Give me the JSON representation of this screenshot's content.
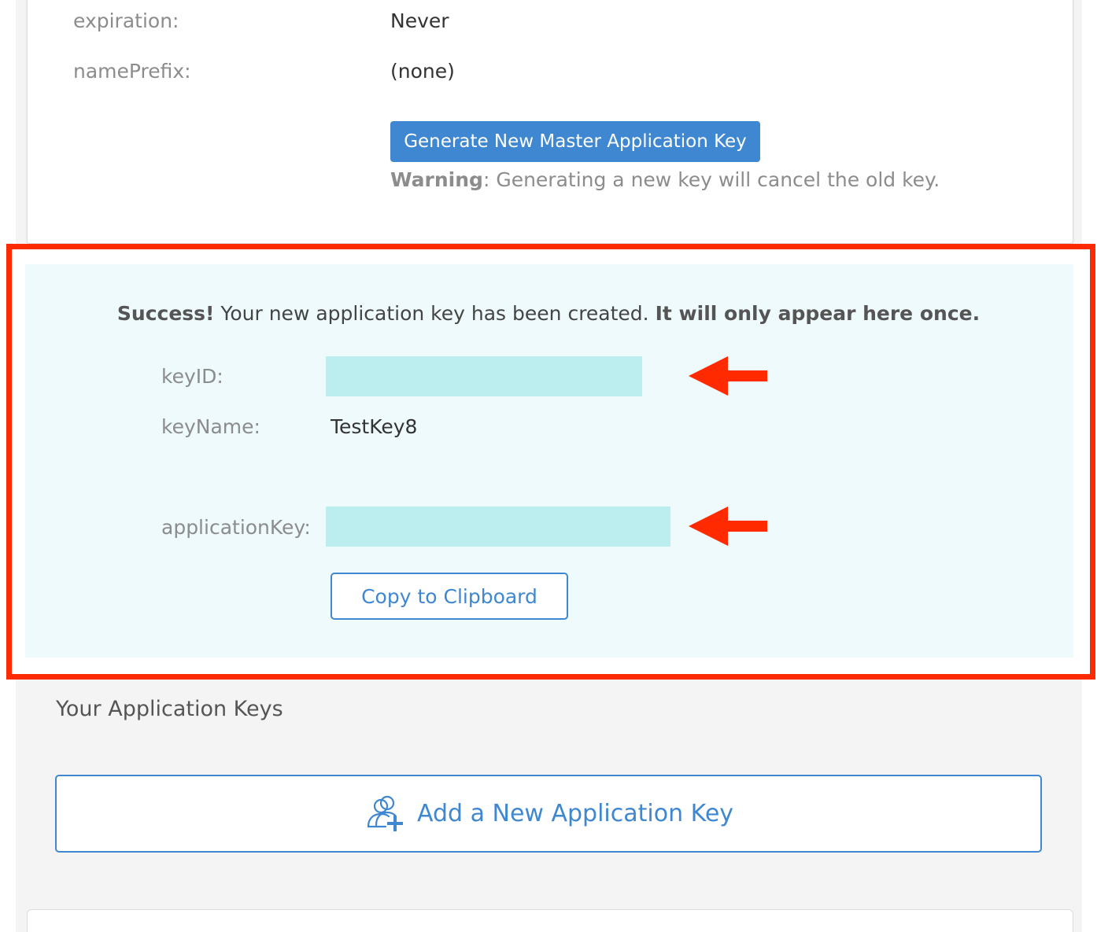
{
  "master_key": {
    "rows": [
      {
        "label": "expiration:",
        "value": "Never"
      },
      {
        "label": "namePrefix:",
        "value": "(none)"
      }
    ],
    "generate_button": "Generate New Master Application Key",
    "warning_strong": "Warning",
    "warning_text": ": Generating a new key will cancel the old key."
  },
  "success": {
    "strong_prefix": "Success!",
    "message": " Your new application key has been created. ",
    "strong_suffix": "It will only appear here once.",
    "fields": {
      "key_id_label": "keyID:",
      "key_name_label": "keyName:",
      "key_name_value": "TestKey8",
      "application_key_label": "applicationKey:"
    },
    "copy_button": "Copy to Clipboard"
  },
  "application_keys": {
    "title": "Your Application Keys",
    "add_button": "Add a New Application Key"
  },
  "colors": {
    "accent": "#3f87d0",
    "highlight_frame": "#ff2a00",
    "success_background": "#eefafc",
    "redaction": "#bdeeef"
  },
  "icons": {
    "add_user": "add-user-icon",
    "annotation_arrow": "arrow-left-icon"
  }
}
